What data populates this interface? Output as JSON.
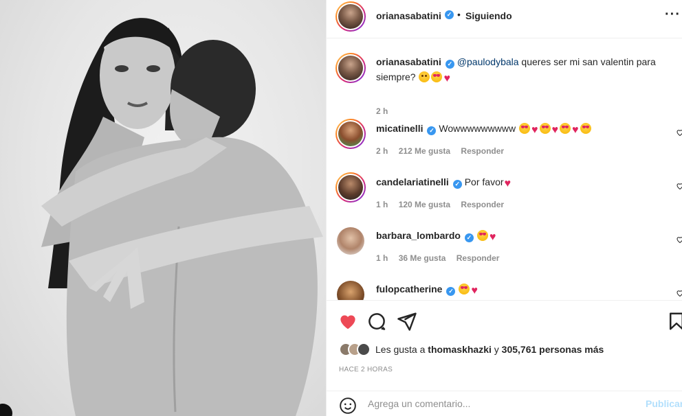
{
  "post": {
    "username": "orianasabatini",
    "follow_dot": "•",
    "follow_status": "Siguiendo",
    "more": "···"
  },
  "caption": {
    "username": "orianasabatini",
    "mention": "@paulodybala",
    "text": " queres ser mi san valentin para siempre?",
    "time": "2 h"
  },
  "comments": [
    {
      "username": "micatinelli",
      "text": "Wowwwwwwwww",
      "time": "2 h",
      "likes": "212 Me gusta",
      "reply": "Responder"
    },
    {
      "username": "candelariatinelli",
      "text": "Por favor",
      "time": "1 h",
      "likes": "120 Me gusta",
      "reply": "Responder"
    },
    {
      "username": "barbara_lombardo",
      "text": "",
      "time": "1 h",
      "likes": "36 Me gusta",
      "reply": "Responder"
    },
    {
      "username": "fulopcatherine",
      "text": ""
    }
  ],
  "likes": {
    "prefix": "Les gusta a ",
    "user": "thomaskhazki",
    "middle": " y ",
    "count": "305,761",
    "suffix": " personas más"
  },
  "timestamp": "HACE 2 HORAS",
  "add_comment": {
    "placeholder": "Agrega un comentario...",
    "publish": "Publicar"
  },
  "icons": {
    "like": "heart-icon",
    "comment": "comment-icon",
    "share": "share-icon",
    "save": "bookmark-icon",
    "emoji": "emoji-icon",
    "more": "more-icon"
  },
  "colors": {
    "liked_heart": "#ed4956",
    "verified": "#3897f0",
    "mention": "#00376b",
    "publish_disabled": "#b2dffc"
  }
}
